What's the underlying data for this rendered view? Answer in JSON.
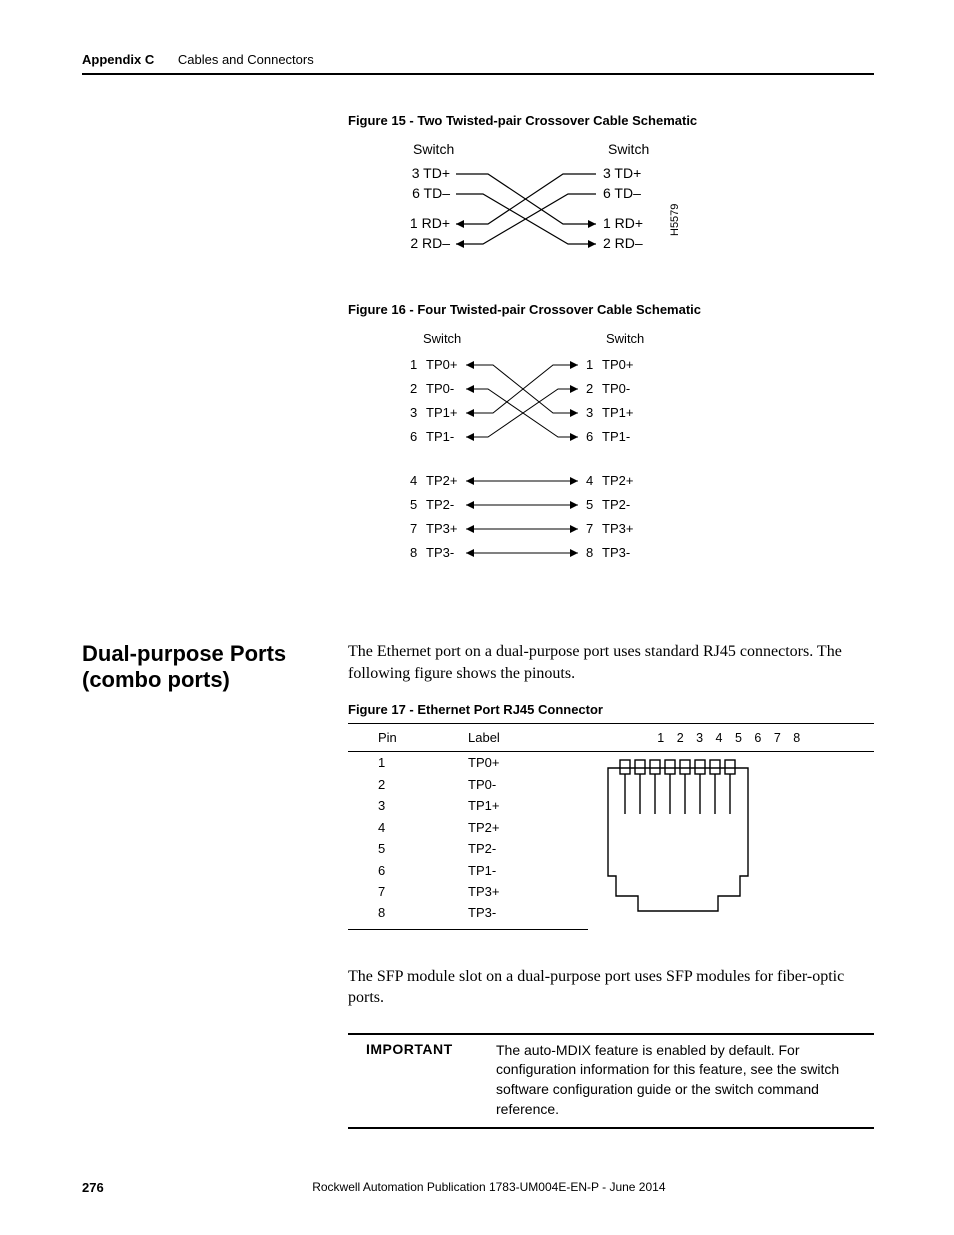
{
  "header": {
    "appendix": "Appendix C",
    "chapter": "Cables and Connectors"
  },
  "figure15": {
    "caption": "Figure 15 - Two Twisted-pair Crossover Cable Schematic",
    "left_title": "Switch",
    "right_title": "Switch",
    "rows_left": [
      "3 TD+",
      "6 TD–",
      "1 RD+",
      "2 RD–"
    ],
    "rows_right": [
      "3 TD+",
      "6 TD–",
      "1 RD+",
      "2 RD–"
    ],
    "side_label": "H5579"
  },
  "figure16": {
    "caption": "Figure 16 - Four Twisted-pair Crossover Cable Schematic",
    "left_title": "Switch",
    "right_title": "Switch",
    "group1_left": [
      {
        "pin": "1",
        "label": "TP0+"
      },
      {
        "pin": "2",
        "label": "TP0-"
      },
      {
        "pin": "3",
        "label": "TP1+"
      },
      {
        "pin": "6",
        "label": "TP1-"
      }
    ],
    "group1_right": [
      {
        "pin": "1",
        "label": "TP0+"
      },
      {
        "pin": "2",
        "label": "TP0-"
      },
      {
        "pin": "3",
        "label": "TP1+"
      },
      {
        "pin": "6",
        "label": "TP1-"
      }
    ],
    "group2_left": [
      {
        "pin": "4",
        "label": "TP2+"
      },
      {
        "pin": "5",
        "label": "TP2-"
      },
      {
        "pin": "7",
        "label": "TP3+"
      },
      {
        "pin": "8",
        "label": "TP3-"
      }
    ],
    "group2_right": [
      {
        "pin": "4",
        "label": "TP2+"
      },
      {
        "pin": "5",
        "label": "TP2-"
      },
      {
        "pin": "7",
        "label": "TP3+"
      },
      {
        "pin": "8",
        "label": "TP3-"
      }
    ]
  },
  "section": {
    "title_line1": "Dual-purpose Ports",
    "title_line2": "(combo ports)",
    "para1": "The Ethernet port on a dual-purpose port uses standard RJ45 connectors. The following figure shows the pinouts.",
    "para2": "The SFP module slot on a dual-purpose port uses SFP modules for fiber-optic ports."
  },
  "figure17": {
    "caption": "Figure 17 - Ethernet Port RJ45 Connector",
    "col_pin": "Pin",
    "col_label": "Label",
    "pin_header": "1 2 3 4 5 6 7 8",
    "rows": [
      {
        "pin": "1",
        "label": "TP0+"
      },
      {
        "pin": "2",
        "label": "TP0-"
      },
      {
        "pin": "3",
        "label": "TP1+"
      },
      {
        "pin": "4",
        "label": "TP2+"
      },
      {
        "pin": "5",
        "label": "TP2-"
      },
      {
        "pin": "6",
        "label": "TP1-"
      },
      {
        "pin": "7",
        "label": "TP3+"
      },
      {
        "pin": "8",
        "label": "TP3-"
      }
    ]
  },
  "important": {
    "label": "IMPORTANT",
    "text": "The auto-MDIX feature is enabled by default. For configuration information for this feature, see the switch software configuration guide or the switch command reference."
  },
  "footer": {
    "page": "276",
    "pub": "Rockwell Automation Publication 1783-UM004E-EN-P - June 2014"
  }
}
